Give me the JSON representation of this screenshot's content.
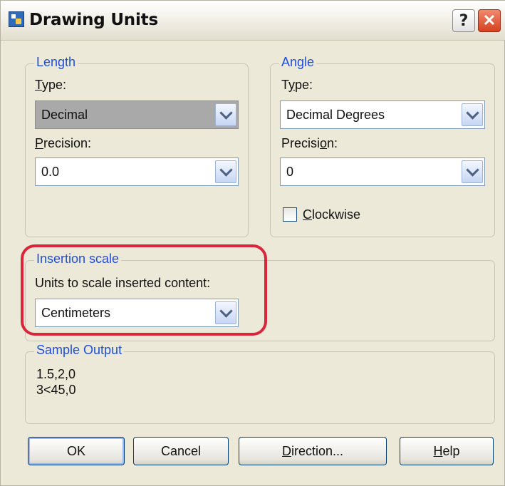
{
  "window": {
    "title": "Drawing Units",
    "help_label": "?",
    "close_label": "✕"
  },
  "length": {
    "legend": "Length",
    "type_label": {
      "accel": "T",
      "rest": "ype:"
    },
    "type_value": "Decimal",
    "precision_label": {
      "accel": "P",
      "rest": "recision:"
    },
    "precision_value": "0.0"
  },
  "angle": {
    "legend": "Angle",
    "type_label": {
      "pre": "T",
      "accel": "y",
      "rest": "pe:"
    },
    "type_value": "Decimal Degrees",
    "precision_label": {
      "pre": "Precisi",
      "accel": "o",
      "rest": "n:"
    },
    "precision_value": "0",
    "clockwise_label": {
      "accel": "C",
      "rest": "lockwise"
    },
    "clockwise_checked": false
  },
  "insertion": {
    "legend": "Insertion scale",
    "units_label": "Units to scale inserted content:",
    "units_value": "Centimeters"
  },
  "sample": {
    "legend": "Sample Output",
    "line1": "1.5,2,0",
    "line2": "3<45,0"
  },
  "buttons": {
    "ok": "OK",
    "cancel": "Cancel",
    "direction": {
      "accel": "D",
      "rest": "irection..."
    },
    "help": {
      "accel": "H",
      "rest": "elp"
    }
  },
  "colors": {
    "legend": "#1f4fd8",
    "highlight": "#d9263d",
    "disabled_field": "#a9a9a9"
  },
  "icons": {
    "dropdown": "chevron-down-icon",
    "app": "drawing-units-icon"
  }
}
